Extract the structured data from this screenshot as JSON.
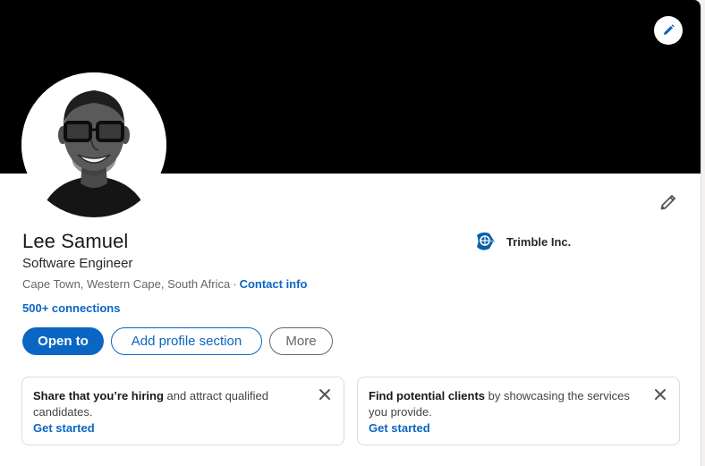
{
  "profile": {
    "name": "Lee Samuel",
    "headline": "Software Engineer",
    "location": "Cape Town, Western Cape, South Africa",
    "separator": "·",
    "contact_info": "Contact info",
    "connections": "500+ connections"
  },
  "company": {
    "name": "Trimble Inc.",
    "logo_icon": "trimble-logo-icon"
  },
  "actions": {
    "open_to": "Open to",
    "add_section": "Add profile section",
    "more": "More"
  },
  "promos": [
    {
      "bold": "Share that you’re hiring",
      "rest": " and attract qualified candidates.",
      "cta": "Get started"
    },
    {
      "bold": "Find potential clients",
      "rest": " by showcasing the services you provide.",
      "cta": "Get started"
    }
  ],
  "colors": {
    "primary": "#0a66c2",
    "banner": "#000000",
    "muted_text": "#666666"
  },
  "icons": {
    "banner_edit": "pencil-icon",
    "profile_edit": "pencil-icon",
    "dismiss": "close-icon"
  }
}
